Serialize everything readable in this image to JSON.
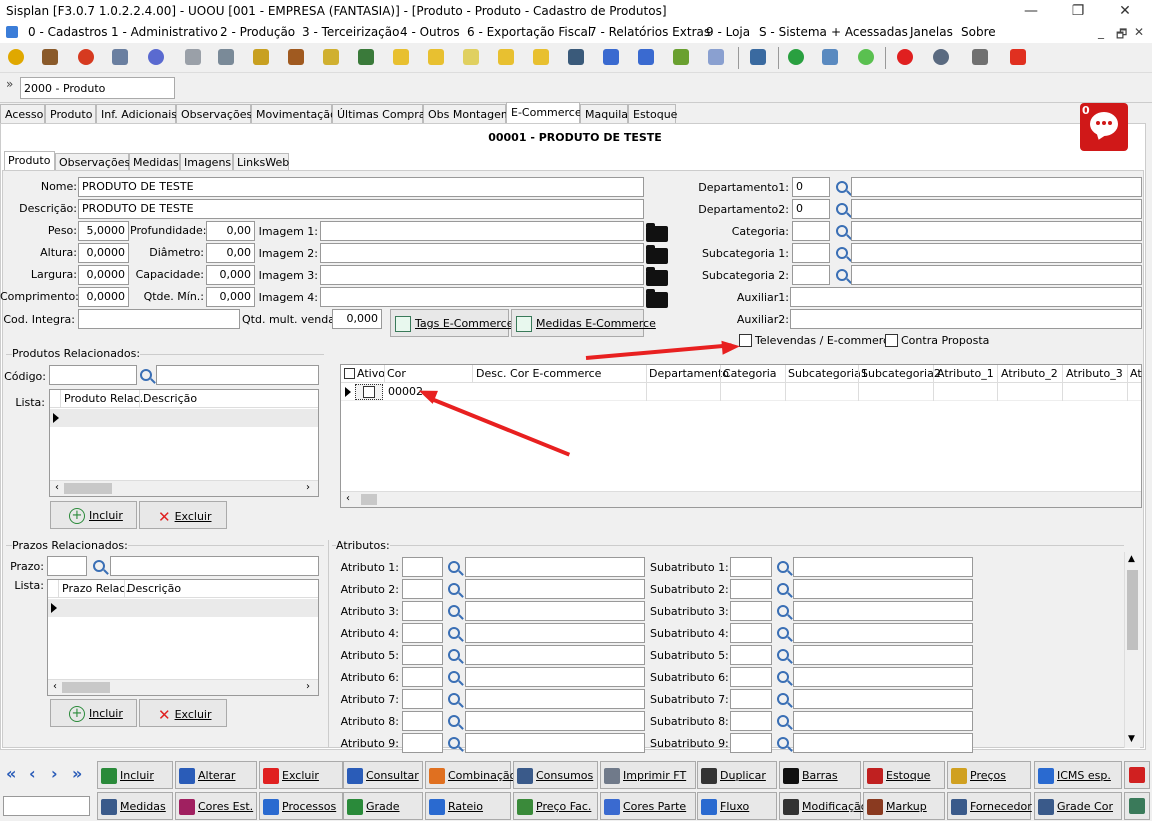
{
  "window": {
    "title": "Sisplan [F3.0.7 1.0.2.2.4.00] - UOOU [001 - EMPRESA (FANTASIA)] - [Produto - Produto - Cadastro de Produtos]",
    "controls": [
      "—",
      "❐",
      "✕"
    ]
  },
  "menu": [
    "0 - Cadastros",
    "1 - Administrativo",
    "2 - Produção",
    "3 - Terceirização",
    "4 - Outros",
    "6 - Exportação Fiscal",
    "7 - Relatórios Extras",
    "9 - Loja",
    "S - Sistema",
    "+ Acessadas",
    "Janelas",
    "Sobre"
  ],
  "menu_controls": [
    "_",
    "🗗",
    "✕"
  ],
  "module": {
    "selected": "2000 - Produto",
    "expand_glyph": "»"
  },
  "tabs": [
    "Acesso",
    "Produto",
    "Inf. Adicionais",
    "Observações",
    "Movimentação",
    "Últimas Compras",
    "Obs Montagem",
    "E-Commerce",
    "Maquila",
    "Estoque"
  ],
  "chat_badge": "0",
  "product_header": "00001 - PRODUTO DE TESTE",
  "subtabs": [
    "Produto",
    "Observações",
    "Medidas",
    "Imagens",
    "LinksWeb"
  ],
  "form": {
    "nome_label": "Nome:",
    "nome": "PRODUTO DE TESTE",
    "descricao_label": "Descrição:",
    "descricao": "PRODUTO DE TESTE",
    "peso_label": "Peso:",
    "peso": "5,0000",
    "altura_label": "Altura:",
    "altura": "0,0000",
    "largura_label": "Largura:",
    "largura": "0,0000",
    "comprimento_label": "Comprimento:",
    "comprimento": "0,0000",
    "profundidade_label": "Profundidade:",
    "profundidade": "0,00",
    "diametro_label": "Diâmetro:",
    "diametro": "0,00",
    "capacidade_label": "Capacidade:",
    "capacidade": "0,000",
    "qtde_min_label": "Qtde. Mín.:",
    "qtde_min": "0,000",
    "imagem1_label": "Imagem 1:",
    "imagem2_label": "Imagem 2:",
    "imagem3_label": "Imagem 3:",
    "imagem4_label": "Imagem 4:",
    "cod_integra_label": "Cod. Integra:",
    "qtd_mult_label": "Qtd. mult. venda:",
    "qtd_mult": "0,000",
    "tags_button": "Tags E-Commerce",
    "medidas_button": "Medidas E-Commerce"
  },
  "right_form": {
    "dep1_label": "Departamento1:",
    "dep1": "0",
    "dep2_label": "Departamento2:",
    "dep2": "0",
    "categoria_label": "Categoria:",
    "subcat1_label": "Subcategoria 1:",
    "subcat2_label": "Subcategoria 2:",
    "aux1_label": "Auxiliar1:",
    "aux2_label": "Auxiliar2:",
    "televendas_label": "Televendas / E-commerce",
    "contra_proposta_label": "Contra Proposta"
  },
  "produtos_relacionados": {
    "title": "Produtos Relacionados:",
    "codigo_label": "Código:",
    "lista_label": "Lista:",
    "columns": [
      "Produto Relac.",
      "Descrição"
    ],
    "incluir": "Incluir",
    "excluir": "Excluir"
  },
  "color_grid": {
    "columns": [
      "Ativo",
      "Cor",
      "Desc. Cor E-commerce",
      "Departamento",
      "Categoria",
      "Subcategoria1",
      "Subcategoria2",
      "Atributo_1",
      "Atributo_2",
      "Atributo_3",
      "At"
    ],
    "rows": [
      {
        "cor": "00002"
      }
    ]
  },
  "prazos": {
    "title": "Prazos Relacionados:",
    "prazo_label": "Prazo:",
    "lista_label": "Lista:",
    "columns": [
      "Prazo Relac.",
      "Descrição"
    ],
    "incluir": "Incluir",
    "excluir": "Excluir"
  },
  "atributos": {
    "title": "Atributos:",
    "atributo_labels": [
      "Atributo 1:",
      "Atributo 2:",
      "Atributo 3:",
      "Atributo 4:",
      "Atributo 5:",
      "Atributo 6:",
      "Atributo 7:",
      "Atributo 8:",
      "Atributo 9:"
    ],
    "subatributo_labels": [
      "Subatributo 1:",
      "Subatributo 2:",
      "Subatributo 3:",
      "Subatributo 4:",
      "Subatributo 5:",
      "Subatributo 6:",
      "Subatributo 7:",
      "Subatributo 8:",
      "Subatributo 9:"
    ]
  },
  "bottom_row1": [
    "Incluir",
    "Alterar",
    "Excluir",
    "Consultar",
    "Combinação",
    "Consumos",
    "Imprimir FT",
    "Duplicar",
    "Barras",
    "Estoque",
    "Preços",
    "ICMS esp."
  ],
  "bottom_row2": [
    "Medidas",
    "Cores Est.",
    "Processos",
    "Grade",
    "Rateio",
    "Preço Fac.",
    "Cores Parte",
    "Fluxo",
    "Modificação",
    "Markup",
    "Fornecedor",
    "Grade Cor"
  ],
  "nav_arrows": [
    "«",
    "‹",
    "›",
    "»"
  ],
  "colors": {
    "accent_red": "#e82020",
    "chat_red": "#d01818",
    "link_blue": "#2a5cb8"
  }
}
